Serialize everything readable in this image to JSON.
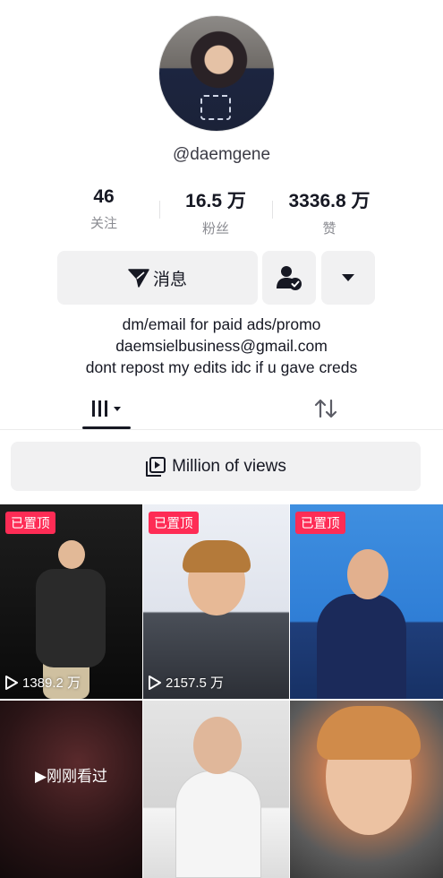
{
  "profile": {
    "handle": "@daemgene",
    "avatar_icon": "profile-photo"
  },
  "stats": [
    {
      "value": "46",
      "label": "关注"
    },
    {
      "value": "16.5 万",
      "label": "粉丝"
    },
    {
      "value": "3336.8 万",
      "label": "赞"
    }
  ],
  "actions": {
    "message_label": "消息",
    "message_icon": "paper-plane-icon",
    "follow_icon": "user-check-icon",
    "more_icon": "caret-down-icon"
  },
  "bio": [
    "dm/email for paid ads/promo",
    "daemsielbusiness@gmail.com",
    "dont repost my edits idc if u gave creds"
  ],
  "tabs": {
    "active": "videos-grid",
    "items": [
      "grid-icon",
      "repost-icon"
    ]
  },
  "playlist": {
    "label": "Million of views",
    "icon": "playlist-icon"
  },
  "videos": [
    {
      "pinned_label": "已置顶",
      "views": "1389.2 万"
    },
    {
      "pinned_label": "已置顶",
      "views": "2157.5 万"
    },
    {
      "pinned_label": "已置顶",
      "views": ""
    },
    {
      "seen_label": "▶刚刚看过"
    },
    {},
    {}
  ],
  "colors": {
    "accent": "#fe2c55",
    "button_bg": "#f1f1f2",
    "text_primary": "#161823",
    "text_secondary": "#8a8b91"
  }
}
